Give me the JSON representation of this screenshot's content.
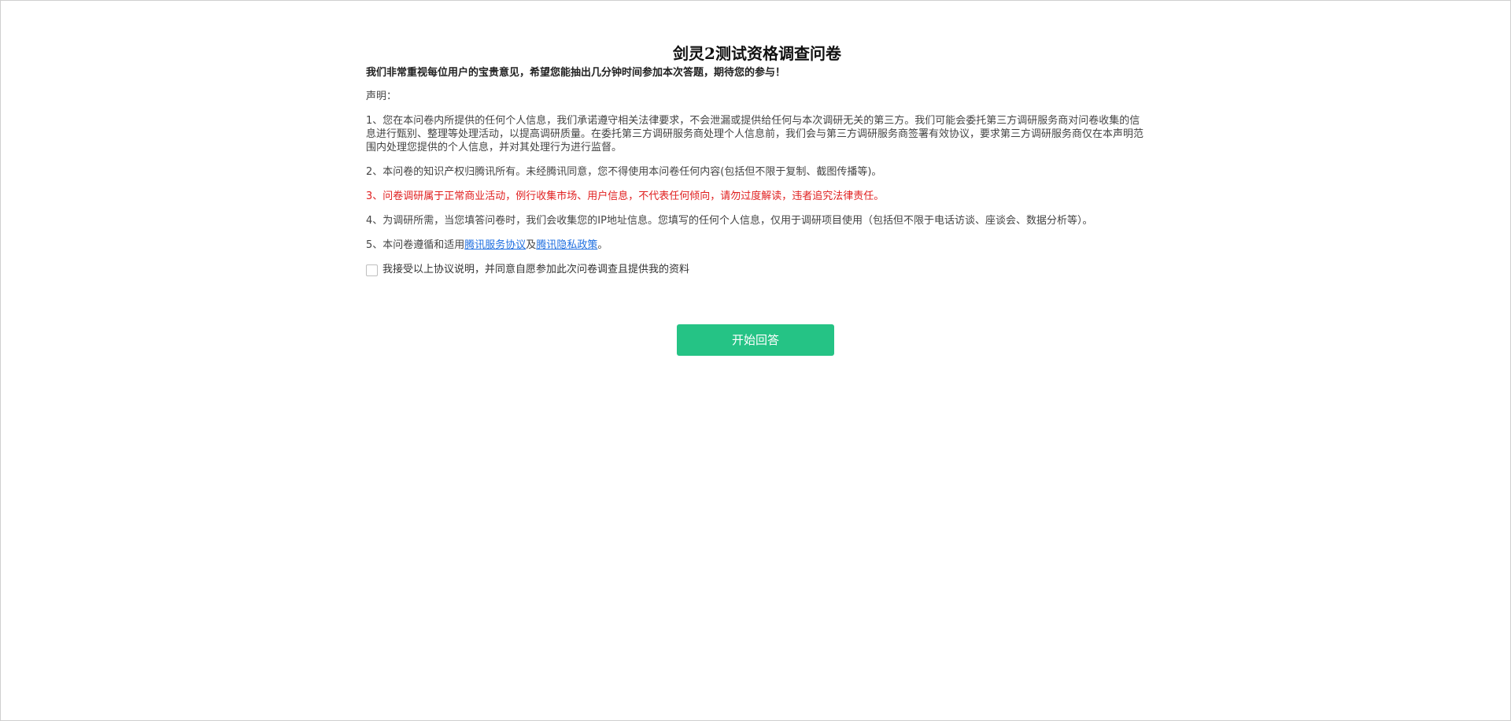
{
  "survey": {
    "title": "剑灵2测试资格调查问卷",
    "intro": "我们非常重视每位用户的宝贵意见，希望您能抽出几分钟时间参加本次答题，期待您的参与！",
    "statement_label": "声明：",
    "item1": "1、您在本问卷内所提供的任何个人信息，我们承诺遵守相关法律要求，不会泄漏或提供给任何与本次调研无关的第三方。我们可能会委托第三方调研服务商对问卷收集的信息进行甄别、整理等处理活动，以提高调研质量。在委托第三方调研服务商处理个人信息前，我们会与第三方调研服务商签署有效协议，要求第三方调研服务商仅在本声明范围内处理您提供的个人信息，并对其处理行为进行监督。",
    "item2": "2、本问卷的知识产权归腾讯所有。未经腾讯同意，您不得使用本问卷任何内容(包括但不限于复制、截图传播等)。",
    "item3": "3、问卷调研属于正常商业活动，例行收集市场、用户信息，不代表任何倾向，请勿过度解读，违者追究法律责任。",
    "item4": "4、为调研所需，当您填答问卷时，我们会收集您的IP地址信息。您填写的任何个人信息，仅用于调研项目使用（包括但不限于电话访谈、座谈会、数据分析等）。",
    "item5_prefix": "5、本问卷遵循和适用",
    "item5_link1": "腾讯服务协议",
    "item5_mid": "及",
    "item5_link2": "腾讯隐私政策",
    "item5_suffix": "。",
    "agree_label": "我接受以上协议说明，并同意自愿参加此次问卷调查且提供我的资料",
    "start_button": "开始回答"
  },
  "colors": {
    "accent": "#25c385",
    "warning": "#e02020",
    "link": "#1f6fe0"
  }
}
